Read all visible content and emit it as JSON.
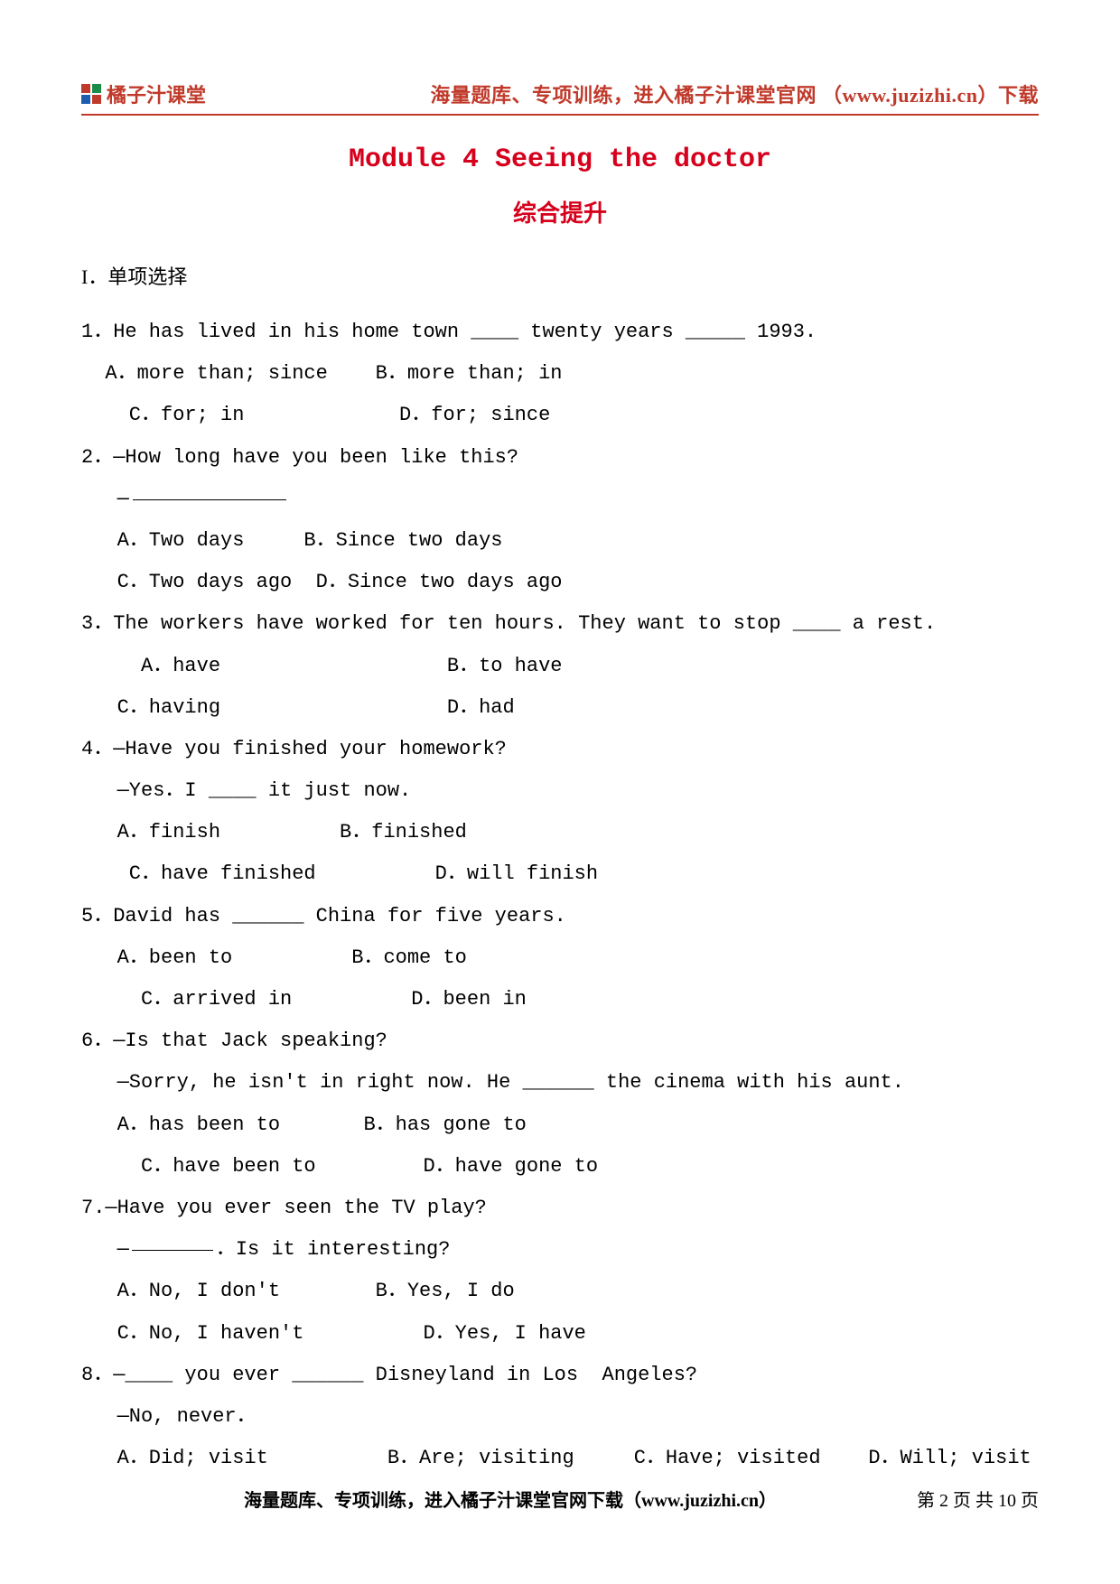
{
  "header": {
    "logo_text": "橘子汁课堂",
    "right_text": "海量题库、专项训练，进入橘子汁课堂官网 （www.juzizhi.cn）下载"
  },
  "titles": {
    "module": "Module 4 Seeing the doctor",
    "subtitle": "综合提升"
  },
  "section_heads": {
    "s1": "I．单项选择"
  },
  "questions": {
    "q1": {
      "stem": "1．He has lived in his home town ____ twenty years _____ 1993.",
      "opt_ab": "  A．more than; since    B．more than; in",
      "opt_cd": "    C．for; in             D．for; since"
    },
    "q2": {
      "stem": "2．—How long have you been like this?",
      "dash": "   —",
      "opt_ab": "   A．Two days     B．Since two days",
      "opt_cd": "   C．Two days ago  D．Since two days ago"
    },
    "q3": {
      "stem": "3．The workers have worked for ten hours. They want to stop ____ a rest.",
      "opt_ab": "     A．have                   B．to have",
      "opt_cd": "   C．having                   D．had"
    },
    "q4": {
      "stem1": "4．—Have you finished your homework?",
      "stem2": "   —Yes．I ____ it just now.",
      "opt_ab": "   A．finish          B．finished",
      "opt_cd": "    C．have finished          D．will finish"
    },
    "q5": {
      "stem": "5．David has ______ China for five years.",
      "opt_ab": "   A．been to          B．come to",
      "opt_cd": "     C．arrived in          D．been in"
    },
    "q6": {
      "stem1": "6．—Is that Jack speaking?",
      "stem2": "   —Sorry, he isn't in right now. He ______ the cinema with his aunt.",
      "opt_ab": "   A．has been to       B．has gone to",
      "opt_cd": "     C．have been to         D．have gone to"
    },
    "q7": {
      "stem1": "7.—Have you ever seen the TV play?",
      "stem2_prefix": "   —",
      "stem2_suffix": "．Is it interesting?",
      "opt_ab": "   A．No, I don't        B．Yes, I do",
      "opt_cd": "   C．No, I haven't          D．Yes, I have"
    },
    "q8": {
      "stem1": "8．—____ you ever ______ Disneyland in Los  Angeles?",
      "stem2": "   —No, never．",
      "opt_abcd": "   A．Did; visit          B．Are; visiting     C．Have; visited    D．Will; visit"
    }
  },
  "footer": {
    "left": "海量题库、专项训练，进入橘子汁课堂官网下载（www.juzizhi.cn）",
    "right": "第 2 页 共 10 页"
  }
}
